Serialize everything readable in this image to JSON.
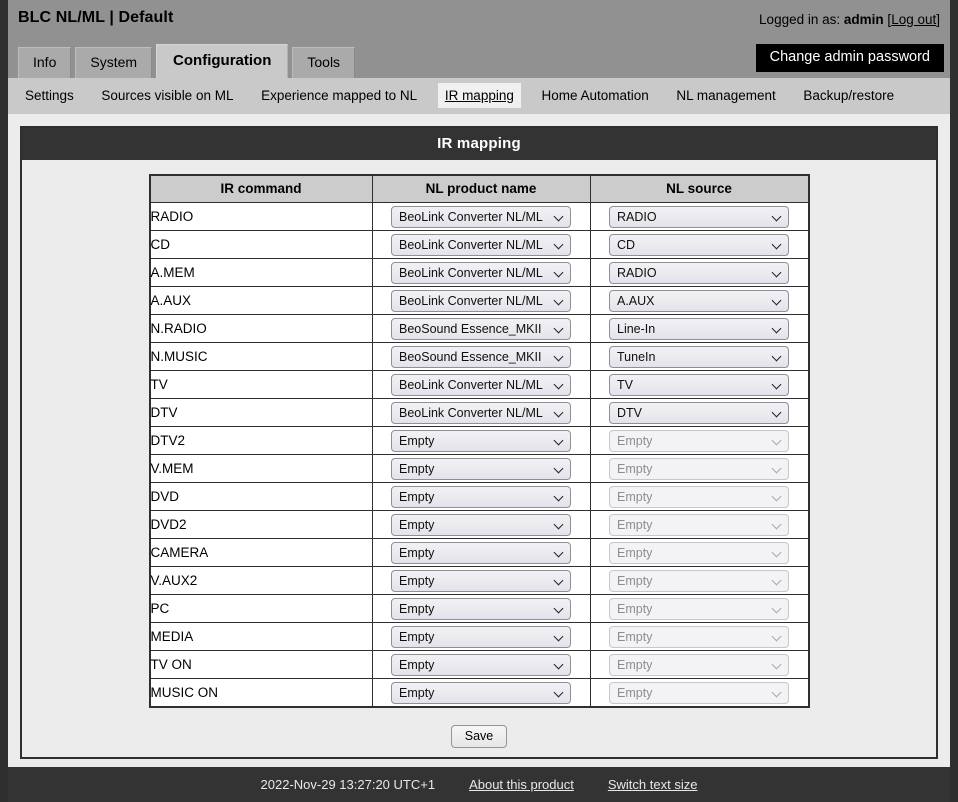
{
  "header": {
    "app_title": "BLC NL/ML | Default",
    "logged_in_prefix": "Logged in as:",
    "user": "admin",
    "logout_open": "[",
    "logout_label": "Log out",
    "logout_close": "]",
    "change_password_label": "Change admin password"
  },
  "tabs": [
    {
      "label": "Info",
      "active": false
    },
    {
      "label": "System",
      "active": false
    },
    {
      "label": "Configuration",
      "active": true
    },
    {
      "label": "Tools",
      "active": false
    }
  ],
  "subnav": [
    {
      "label": "Settings",
      "active": false
    },
    {
      "label": "Sources visible on ML",
      "active": false
    },
    {
      "label": "Experience mapped to NL",
      "active": false
    },
    {
      "label": "IR mapping",
      "active": true
    },
    {
      "label": "Home Automation",
      "active": false
    },
    {
      "label": "NL management",
      "active": false
    },
    {
      "label": "Backup/restore",
      "active": false
    }
  ],
  "panel": {
    "title": "IR mapping",
    "columns": [
      "IR command",
      "NL product name",
      "NL source"
    ],
    "rows": [
      {
        "command": "RADIO",
        "product": "BeoLink Converter NL/ML",
        "source": "RADIO",
        "source_disabled": false
      },
      {
        "command": "CD",
        "product": "BeoLink Converter NL/ML",
        "source": "CD",
        "source_disabled": false
      },
      {
        "command": "A.MEM",
        "product": "BeoLink Converter NL/ML",
        "source": "RADIO",
        "source_disabled": false
      },
      {
        "command": "A.AUX",
        "product": "BeoLink Converter NL/ML",
        "source": "A.AUX",
        "source_disabled": false
      },
      {
        "command": "N.RADIO",
        "product": "BeoSound Essence_MKII",
        "source": "Line-In",
        "source_disabled": false
      },
      {
        "command": "N.MUSIC",
        "product": "BeoSound Essence_MKII",
        "source": "TuneIn",
        "source_disabled": false
      },
      {
        "command": "TV",
        "product": "BeoLink Converter NL/ML",
        "source": "TV",
        "source_disabled": false
      },
      {
        "command": "DTV",
        "product": "BeoLink Converter NL/ML",
        "source": "DTV",
        "source_disabled": false
      },
      {
        "command": "DTV2",
        "product": "Empty",
        "source": "Empty",
        "source_disabled": true
      },
      {
        "command": "V.MEM",
        "product": "Empty",
        "source": "Empty",
        "source_disabled": true
      },
      {
        "command": "DVD",
        "product": "Empty",
        "source": "Empty",
        "source_disabled": true
      },
      {
        "command": "DVD2",
        "product": "Empty",
        "source": "Empty",
        "source_disabled": true
      },
      {
        "command": "CAMERA",
        "product": "Empty",
        "source": "Empty",
        "source_disabled": true
      },
      {
        "command": "V.AUX2",
        "product": "Empty",
        "source": "Empty",
        "source_disabled": true
      },
      {
        "command": "PC",
        "product": "Empty",
        "source": "Empty",
        "source_disabled": true
      },
      {
        "command": "MEDIA",
        "product": "Empty",
        "source": "Empty",
        "source_disabled": true
      },
      {
        "command": "TV ON",
        "product": "Empty",
        "source": "Empty",
        "source_disabled": true
      },
      {
        "command": "MUSIC ON",
        "product": "Empty",
        "source": "Empty",
        "source_disabled": true
      }
    ],
    "save_label": "Save"
  },
  "footer": {
    "timestamp": "2022-Nov-29 13:27:20 UTC+1",
    "about_label": "About this product",
    "text_size_label": "Switch text size"
  },
  "colors": {
    "topbar": "#919191",
    "subnav": "#c9c9c9",
    "panel_header": "#333333",
    "page_bg": "#ececec",
    "frame": "#2f2f2f",
    "accent_black": "#000000"
  }
}
